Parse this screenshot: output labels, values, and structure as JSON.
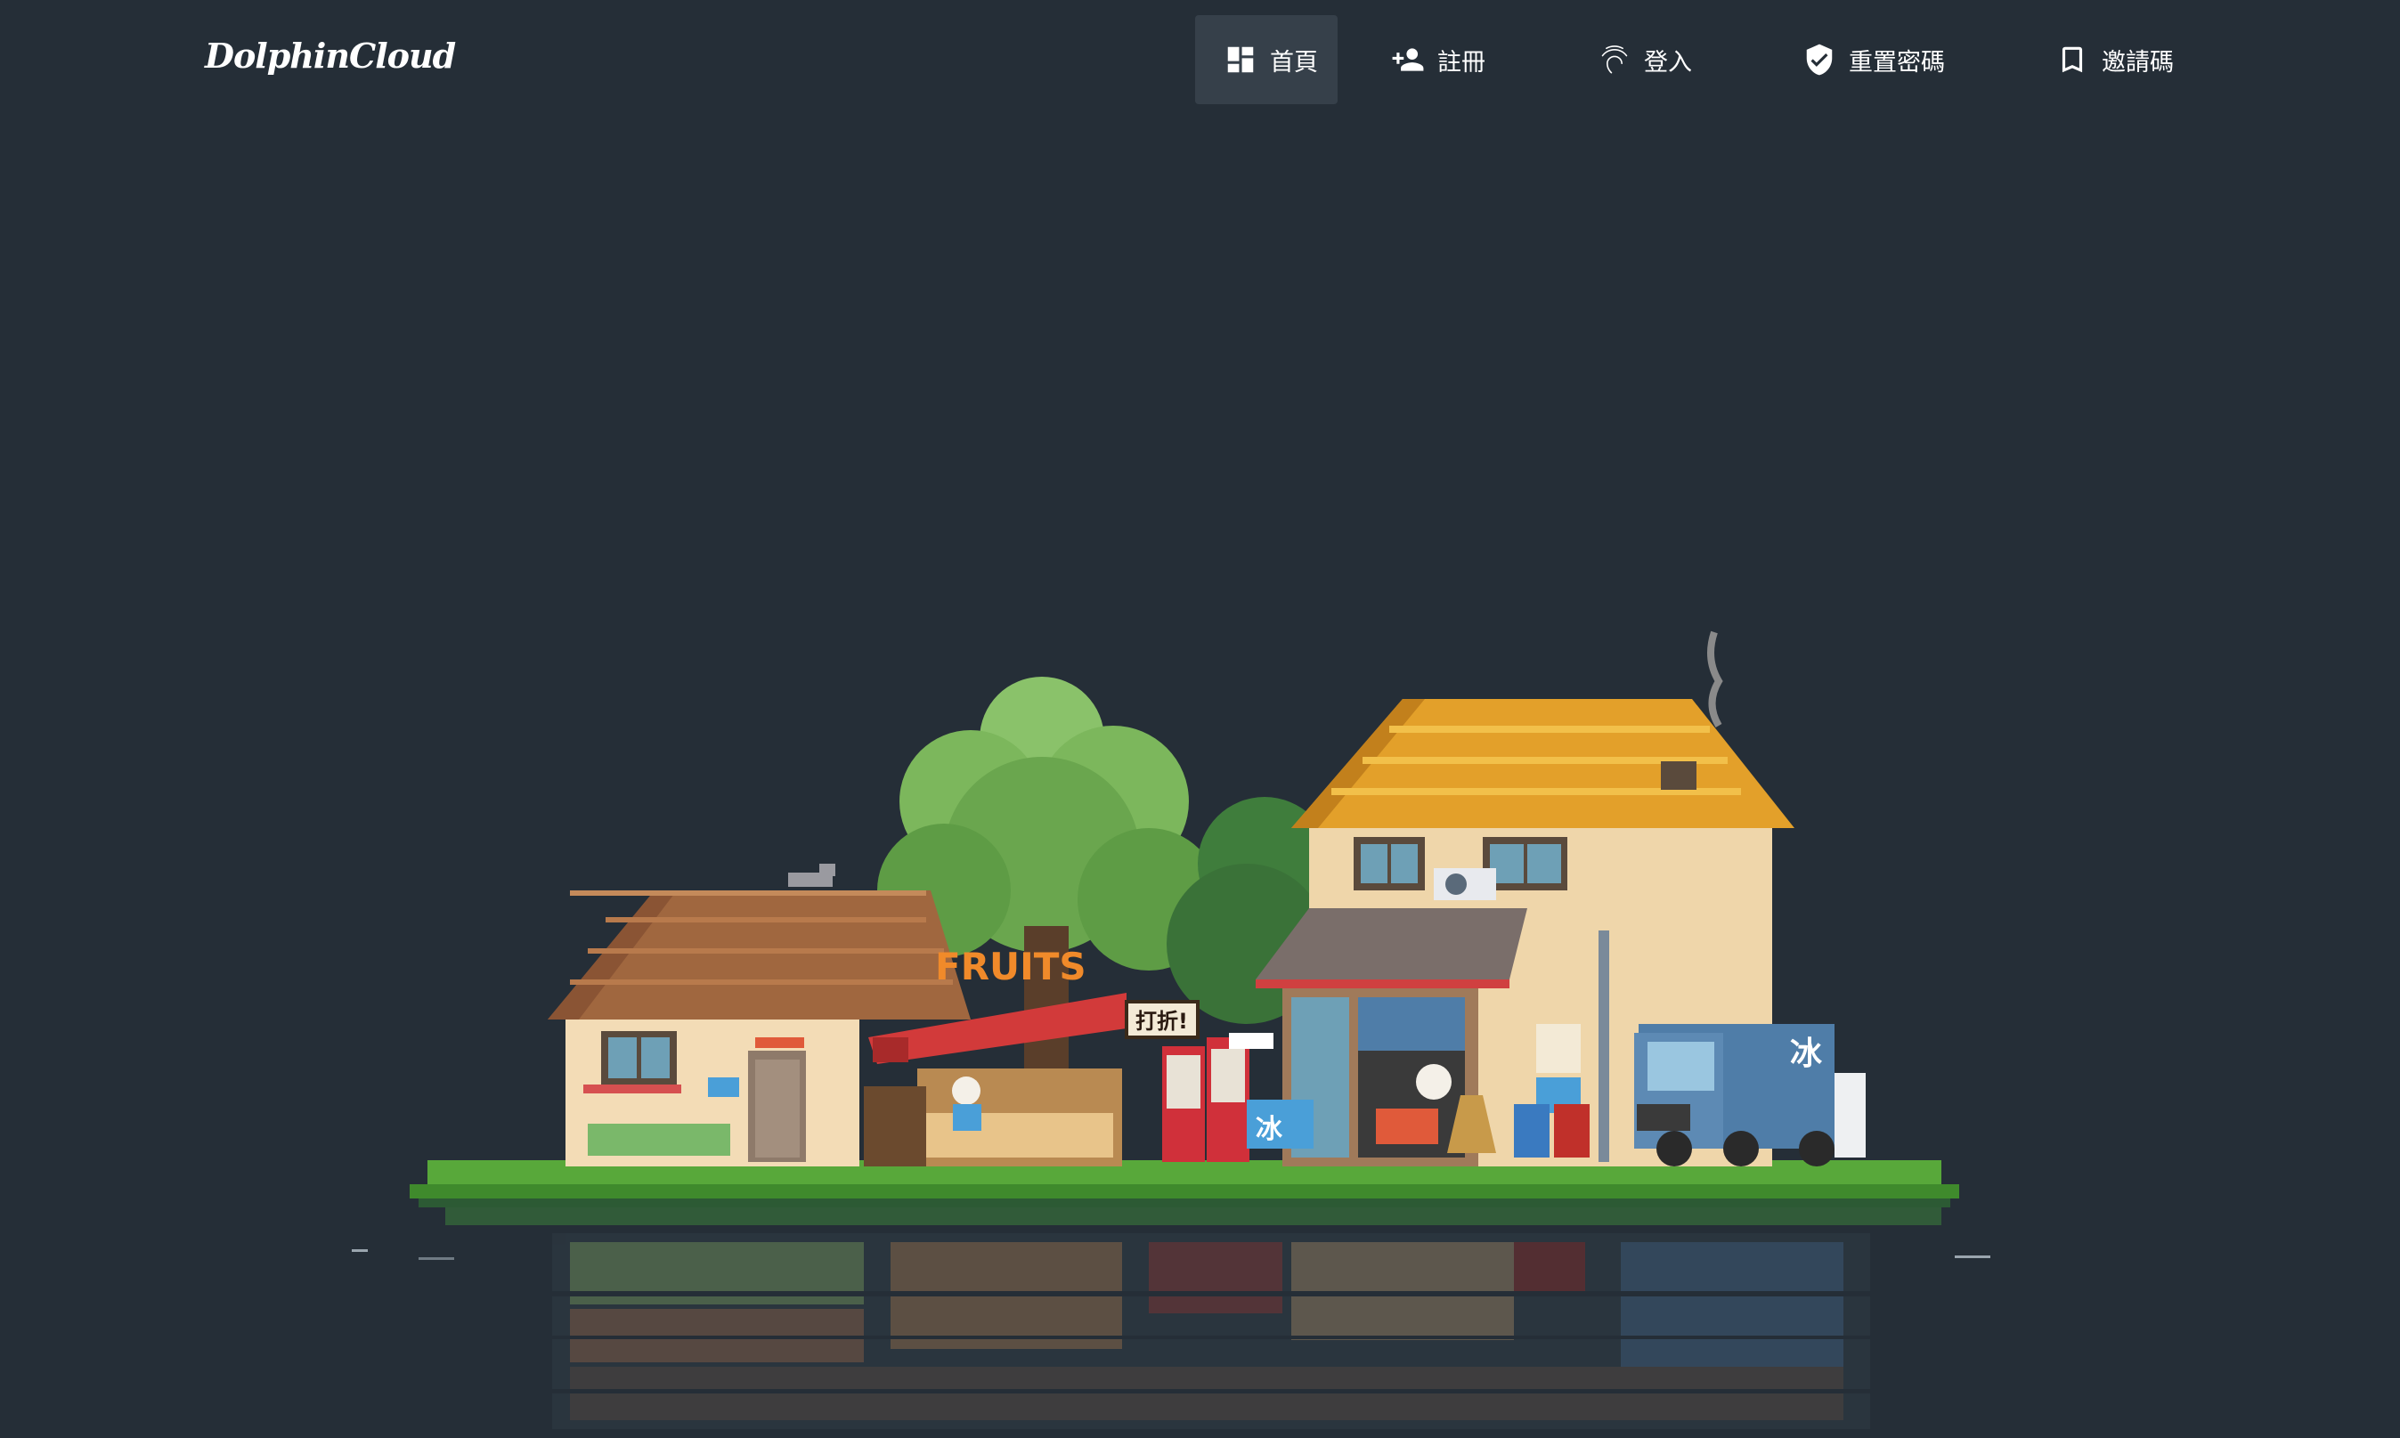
{
  "header": {
    "logo_text": "DolphinCloud"
  },
  "nav": {
    "items": [
      {
        "label": "首頁",
        "icon": "dashboard-icon",
        "active": true
      },
      {
        "label": "註冊",
        "icon": "person-add-icon",
        "active": false
      },
      {
        "label": "登入",
        "icon": "fingerprint-icon",
        "active": false
      },
      {
        "label": "重置密碼",
        "icon": "shield-check-icon",
        "active": false
      },
      {
        "label": "邀請碼",
        "icon": "bookmark-icon",
        "active": false
      }
    ]
  },
  "illustration": {
    "fruit_sign": "FRUITS",
    "discount_sign": "打折!",
    "ice_label": "冰",
    "truck_label": "冰"
  },
  "colors": {
    "background": "#252e37",
    "nav_active": "#36404a",
    "text": "#ffffff"
  }
}
